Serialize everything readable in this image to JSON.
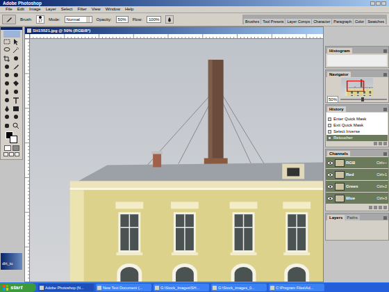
{
  "window": {
    "title": "Adobe Photoshop"
  },
  "menu": [
    "File",
    "Edit",
    "Image",
    "Layer",
    "Select",
    "Filter",
    "View",
    "Window",
    "Help"
  ],
  "options": {
    "brush_label": "Brush:",
    "brush_size": "17",
    "mode_label": "Mode:",
    "mode": "Normal",
    "opacity_label": "Opacity:",
    "opacity": "50%",
    "flow_label": "Flow:",
    "flow": "100%"
  },
  "palette_well": [
    "Brushes",
    "Tool Presets",
    "Layer Comps",
    "Character",
    "Paragraph",
    "Color",
    "Swatches"
  ],
  "document": {
    "title": "SH15521.jpg @ 50% (RGB/8*)"
  },
  "histogram": {
    "tab": "Histogram"
  },
  "navigator": {
    "tab": "Navigator",
    "zoom": "50%",
    "level": 0.45
  },
  "history": {
    "tab": "History",
    "items": [
      {
        "label": "Enter Quick Mask",
        "selected": false
      },
      {
        "label": "Exit Quick Mask",
        "selected": false
      },
      {
        "label": "Select Inverse",
        "selected": false
      },
      {
        "label": "Retoucher",
        "selected": true
      }
    ]
  },
  "channels": {
    "tab": "Channels",
    "items": [
      {
        "name": "RGB",
        "shortcut": "Ctrl+~",
        "visible": true,
        "selected": true
      },
      {
        "name": "Red",
        "shortcut": "Ctrl+1",
        "visible": true,
        "selected": true
      },
      {
        "name": "Green",
        "shortcut": "Ctrl+2",
        "visible": true,
        "selected": true
      },
      {
        "name": "Blue",
        "shortcut": "Ctrl+3",
        "visible": true,
        "selected": true
      }
    ]
  },
  "layers_tabs": [
    {
      "label": "Layers",
      "selected": true
    },
    {
      "label": "Paths",
      "selected": false
    }
  ],
  "minimized_doc": "dlrt_tu",
  "taskbar": {
    "start": "start",
    "items": [
      {
        "label": "Adobe Photoshop (N...",
        "selected": true
      },
      {
        "label": "New Text Document (...",
        "selected": false
      },
      {
        "label": "G:\\Stock_Images\\SH...",
        "selected": false
      },
      {
        "label": "G:\\Stock_images_0...",
        "selected": false
      },
      {
        "label": "C:\\Program Files\\Ad...",
        "selected": false
      }
    ]
  }
}
